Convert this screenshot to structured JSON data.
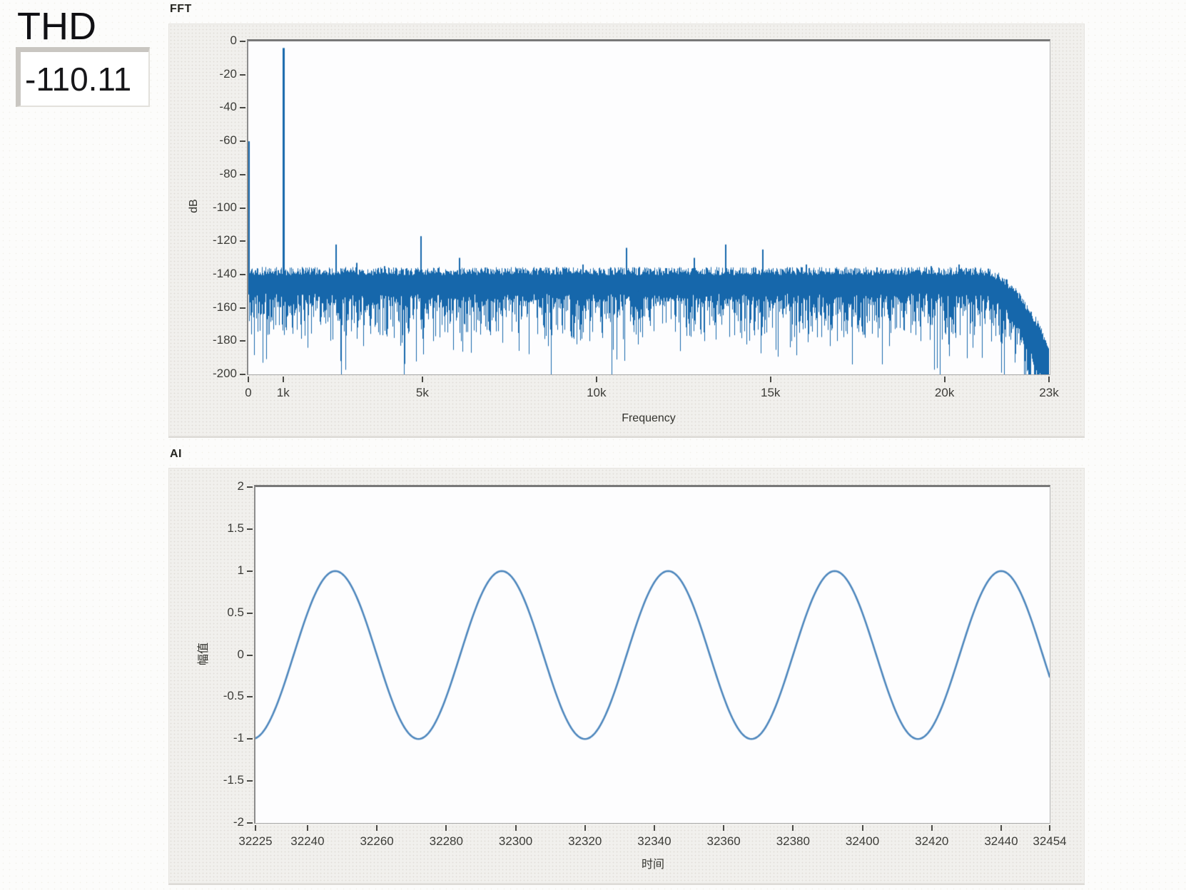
{
  "thd": {
    "label": "THD",
    "value": "-110.11"
  },
  "fft_graph": {
    "caption": "FFT"
  },
  "ai_graph": {
    "caption": "AI"
  },
  "chart_data": [
    {
      "id": "fft",
      "type": "line",
      "title": "FFT",
      "xlabel": "Frequency",
      "ylabel": "dB",
      "xlim": [
        0,
        23000
      ],
      "ylim": [
        -200,
        0
      ],
      "grid": false,
      "line_color": "#1667ab",
      "x_ticks": [
        {
          "value": 0,
          "label": "0"
        },
        {
          "value": 1000,
          "label": "1k"
        },
        {
          "value": 5000,
          "label": "5k"
        },
        {
          "value": 10000,
          "label": "10k"
        },
        {
          "value": 15000,
          "label": "15k"
        },
        {
          "value": 20000,
          "label": "20k"
        },
        {
          "value": 23000,
          "label": "23k"
        }
      ],
      "y_ticks": [
        {
          "value": 0,
          "label": "0"
        },
        {
          "value": -20,
          "label": "-20"
        },
        {
          "value": -40,
          "label": "-40"
        },
        {
          "value": -60,
          "label": "-60"
        },
        {
          "value": -80,
          "label": "-80"
        },
        {
          "value": -100,
          "label": "-100"
        },
        {
          "value": -120,
          "label": "-120"
        },
        {
          "value": -140,
          "label": "-140"
        },
        {
          "value": -160,
          "label": "-160"
        },
        {
          "value": -180,
          "label": "-180"
        },
        {
          "value": -200,
          "label": "-200"
        }
      ],
      "noise_floor": {
        "top_db": -138,
        "band_bottom_db": -160,
        "deep_spike_db": -196,
        "deep_spike_prob": 0.05,
        "rolloff_start_hz": 21000,
        "rolloff_end_db": -200,
        "seed": 7
      },
      "peaks": [
        {
          "hz": 0,
          "db": -60
        },
        {
          "hz": 1000,
          "db": -4
        },
        {
          "hz": 2500,
          "db": -122
        },
        {
          "hz": 3100,
          "db": -133
        },
        {
          "hz": 3900,
          "db": -135
        },
        {
          "hz": 4950,
          "db": -117
        },
        {
          "hz": 6050,
          "db": -130
        },
        {
          "hz": 7900,
          "db": -137
        },
        {
          "hz": 9600,
          "db": -134
        },
        {
          "hz": 10850,
          "db": -124
        },
        {
          "hz": 11900,
          "db": -138
        },
        {
          "hz": 12800,
          "db": -130
        },
        {
          "hz": 13700,
          "db": -122
        },
        {
          "hz": 14750,
          "db": -125
        },
        {
          "hz": 16000,
          "db": -134
        },
        {
          "hz": 19600,
          "db": -135
        },
        {
          "hz": 20400,
          "db": -134
        }
      ],
      "deep_spikes": [
        {
          "hz": 420,
          "db": -193
        },
        {
          "hz": 1700,
          "db": -184
        },
        {
          "hz": 2650,
          "db": -192
        },
        {
          "hz": 3300,
          "db": -183
        },
        {
          "hz": 4400,
          "db": -181
        },
        {
          "hz": 5300,
          "db": -180
        },
        {
          "hz": 6400,
          "db": -187
        },
        {
          "hz": 7300,
          "db": -181
        },
        {
          "hz": 8600,
          "db": -183
        },
        {
          "hz": 9800,
          "db": -180
        },
        {
          "hz": 11200,
          "db": -182
        },
        {
          "hz": 12400,
          "db": -186
        },
        {
          "hz": 13100,
          "db": -180
        },
        {
          "hz": 14300,
          "db": -182
        },
        {
          "hz": 15600,
          "db": -180
        },
        {
          "hz": 16700,
          "db": -183
        },
        {
          "hz": 17350,
          "db": -194
        },
        {
          "hz": 18400,
          "db": -183
        },
        {
          "hz": 19300,
          "db": -180
        },
        {
          "hz": 20100,
          "db": -182
        },
        {
          "hz": 20800,
          "db": -184
        }
      ]
    },
    {
      "id": "ai",
      "type": "line",
      "title": "AI",
      "xlabel": "时间",
      "ylabel": "幅值",
      "xlim": [
        32225,
        32454
      ],
      "ylim": [
        -2,
        2
      ],
      "grid": false,
      "line_color": "#4e87bd",
      "waveform": {
        "shape": "sine",
        "amplitude": 1,
        "period": 48,
        "minimum_at_x": 32224,
        "formula": "y = -cos(2*pi*(x-32224)/48)"
      },
      "x_ticks": [
        {
          "value": 32225,
          "label": "32225"
        },
        {
          "value": 32240,
          "label": "32240"
        },
        {
          "value": 32260,
          "label": "32260"
        },
        {
          "value": 32280,
          "label": "32280"
        },
        {
          "value": 32300,
          "label": "32300"
        },
        {
          "value": 32320,
          "label": "32320"
        },
        {
          "value": 32340,
          "label": "32340"
        },
        {
          "value": 32360,
          "label": "32360"
        },
        {
          "value": 32380,
          "label": "32380"
        },
        {
          "value": 32400,
          "label": "32400"
        },
        {
          "value": 32420,
          "label": "32420"
        },
        {
          "value": 32440,
          "label": "32440"
        },
        {
          "value": 32454,
          "label": "32454"
        }
      ],
      "y_ticks": [
        {
          "value": 2,
          "label": "2"
        },
        {
          "value": 1.5,
          "label": "1.5"
        },
        {
          "value": 1,
          "label": "1"
        },
        {
          "value": 0.5,
          "label": "0.5"
        },
        {
          "value": 0,
          "label": "0"
        },
        {
          "value": -0.5,
          "label": "-0.5"
        },
        {
          "value": -1,
          "label": "-1"
        },
        {
          "value": -1.5,
          "label": "-1.5"
        },
        {
          "value": -2,
          "label": "-2"
        }
      ]
    }
  ]
}
